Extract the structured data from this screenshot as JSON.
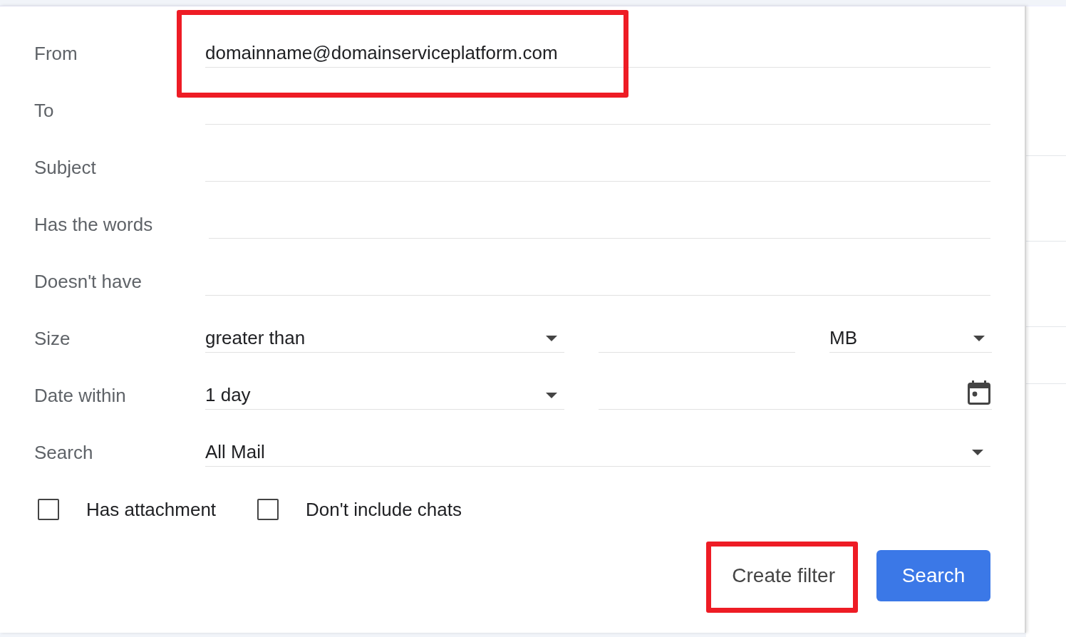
{
  "fields": [
    {
      "kind": "text",
      "label": "From",
      "value": "domainname@domainserviceplatform.com",
      "highlighted": true
    },
    {
      "kind": "text",
      "label": "To",
      "highlighted": false
    },
    {
      "kind": "text",
      "label": "Subject",
      "highlighted": false
    },
    {
      "kind": "text",
      "label": "Has the words",
      "highlighted": false
    },
    {
      "kind": "text",
      "label": "Doesn't have",
      "highlighted": false
    },
    {
      "kind": "size",
      "label": "Size",
      "comparison": "greater than",
      "unit": "MB",
      "highlighted": false
    },
    {
      "kind": "date",
      "label": "Date within",
      "value": "1 day",
      "highlighted": false
    },
    {
      "kind": "select",
      "label": "Search",
      "value": "All Mail",
      "highlighted": false
    }
  ],
  "checkboxes": [
    {
      "label": "Has attachment",
      "checked": false
    },
    {
      "label": "Don't include chats",
      "checked": false
    }
  ],
  "buttons": [
    {
      "kind": "text",
      "label": "Create filter",
      "highlighted": true
    },
    {
      "kind": "primary",
      "label": "Search",
      "highlighted": false
    }
  ]
}
